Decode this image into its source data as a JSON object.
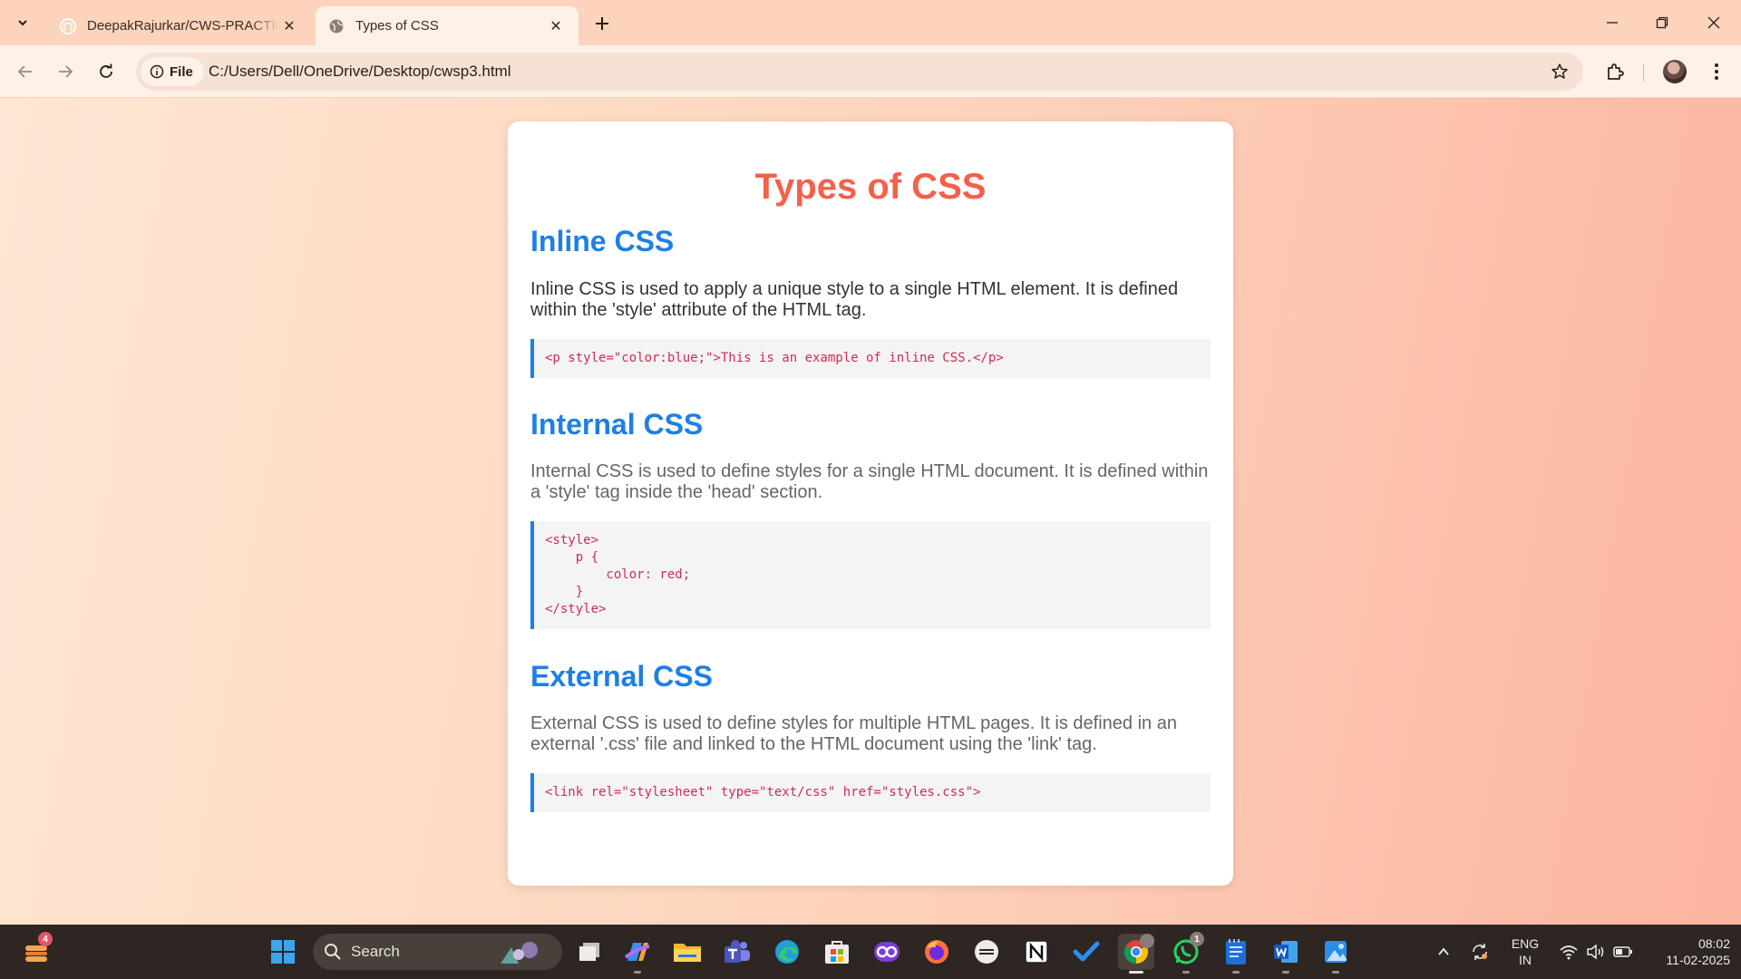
{
  "browser": {
    "tabs": [
      {
        "title": "DeepakRajurkar/CWS-PRACTICAL",
        "icon": "github-icon",
        "active": false
      },
      {
        "title": "Types of CSS",
        "icon": "globe-icon",
        "active": true
      }
    ],
    "address": {
      "chip_label": "File",
      "url": "C:/Users/Dell/OneDrive/Desktop/cwsp3.html"
    }
  },
  "page": {
    "title": "Types of CSS",
    "sections": [
      {
        "heading": "Inline CSS",
        "description": "Inline CSS is used to apply a unique style to a single HTML element. It is defined within the 'style' attribute of the HTML tag.",
        "code": "<p style=\"color:blue;\">This is an example of inline CSS.</p>"
      },
      {
        "heading": "Internal CSS",
        "description": "Internal CSS is used to define styles for a single HTML document. It is defined within a 'style' tag inside the 'head' section.",
        "code": "<style>\n    p {\n        color: red;\n    }\n</style>"
      },
      {
        "heading": "External CSS",
        "description": "External CSS is used to define styles for multiple HTML pages. It is defined in an external '.css' file and linked to the HTML document using the 'link' tag.",
        "code": "<link rel=\"stylesheet\" type=\"text/css\" href=\"styles.css\">"
      }
    ]
  },
  "taskbar": {
    "weather_badge": "4",
    "search_placeholder": "Search",
    "whatsapp_badge": "1",
    "language": "ENG",
    "region": "IN",
    "time": "08:02",
    "date": "11-02-2025"
  },
  "colors": {
    "title": "#f3614a",
    "heading": "#1f7fe3",
    "code_text": "#cf2c55",
    "code_border": "#1f7fe3"
  }
}
